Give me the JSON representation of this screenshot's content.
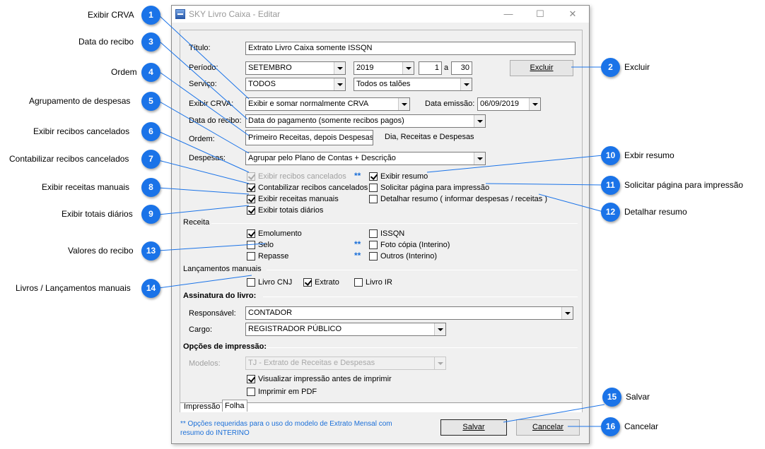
{
  "window": {
    "title": "SKY Livro Caixa - Editar",
    "controls": [
      "—",
      "☐",
      "✕"
    ]
  },
  "form": {
    "titulo_label": "Título:",
    "titulo_value": "Extrato Livro Caixa somente ISSQN",
    "periodo_label": "Período:",
    "periodo_mes": "SETEMBRO",
    "periodo_ano": "2019",
    "periodo_de": "1",
    "periodo_a_label": "a",
    "periodo_ate": "30",
    "excluir_label": "Excluir",
    "servico_label": "Serviço:",
    "servico_value": "TODOS",
    "servico_taloes": "Todos os talões",
    "exibir_crva_label": "Exibir CRVA:",
    "exibir_crva_value": "Exibir e somar normalmente CRVA",
    "data_emissao_label": "Data emissão:",
    "data_emissao_value": "06/09/2019",
    "data_recibo_label": "Data do recibo:",
    "data_recibo_value": "Data do pagamento (somente recibos pagos)",
    "ordem_label": "Ordem:",
    "ordem_opt1": "Primeiro Receitas, depois Despesas",
    "ordem_opt2": "Dia, Receitas e Despesas",
    "despesas_label": "Despesas:",
    "despesas_value": "Agrupar pelo Plano de Contas + Descrição"
  },
  "checks": {
    "exibir_cancelados": "Exibir recibos cancelados",
    "contabilizar_cancelados": "Contabilizar recibos cancelados",
    "exibir_receitas_manuais": "Exibir receitas manuais",
    "exibir_totais_diarios": "Exibir totais diários",
    "exibir_resumo": "Exibir resumo",
    "solicitar_pagina": "Solicitar página para impressão",
    "detalhar_resumo": "Detalhar resumo ( informar despesas / receitas )",
    "star": "**"
  },
  "receita": {
    "title": "Receita",
    "emolumento": "Emolumento",
    "selo": "Selo",
    "repasse": "Repasse",
    "issqn": "ISSQN",
    "foto_copia": "Foto cópia (Interino)",
    "outros": "Outros (Interino)"
  },
  "lancamentos": {
    "title": "Lançamentos manuais",
    "livro_cnj": "Livro CNJ",
    "extrato": "Extrato",
    "livro_ir": "Livro IR"
  },
  "assinatura": {
    "title": "Assinatura do livro:",
    "responsavel_label": "Responsável:",
    "responsavel_value": "CONTADOR",
    "cargo_label": "Cargo:",
    "cargo_value": "REGISTRADOR PÚBLICO"
  },
  "impressao": {
    "title": "Opções de impressão:",
    "modelos_label": "Modelos:",
    "modelos_value": "TJ - Extrato de Receitas e Despesas",
    "visualizar": "Visualizar impressão antes de imprimir",
    "imprimir_pdf": "Imprimir em PDF"
  },
  "tabs": [
    "Impressão",
    "Folha"
  ],
  "footer": {
    "note_line1": "** Opções requeridas para o uso do modelo de Extrato Mensal com",
    "note_line2": "resumo do INTERINO",
    "salvar": "Salvar",
    "cancelar": "Cancelar"
  },
  "callouts": [
    {
      "n": "1",
      "label": "Exibir CRVA"
    },
    {
      "n": "2",
      "label": "Excluir"
    },
    {
      "n": "3",
      "label": "Data do recibo"
    },
    {
      "n": "4",
      "label": "Ordem"
    },
    {
      "n": "5",
      "label": "Agrupamento de despesas"
    },
    {
      "n": "6",
      "label": "Exibir recibos cancelados"
    },
    {
      "n": "7",
      "label": "Contabilizar recibos cancelados"
    },
    {
      "n": "8",
      "label": "Exibir receitas manuais"
    },
    {
      "n": "9",
      "label": "Exibir totais diários"
    },
    {
      "n": "10",
      "label": "Exbir resumo"
    },
    {
      "n": "11",
      "label": "Solicitar página para impressão"
    },
    {
      "n": "12",
      "label": "Detalhar resumo"
    },
    {
      "n": "13",
      "label": "Valores do recibo"
    },
    {
      "n": "14",
      "label": "Livros / Lançamentos manuais"
    },
    {
      "n": "15",
      "label": "Salvar"
    },
    {
      "n": "16",
      "label": "Cancelar"
    }
  ]
}
